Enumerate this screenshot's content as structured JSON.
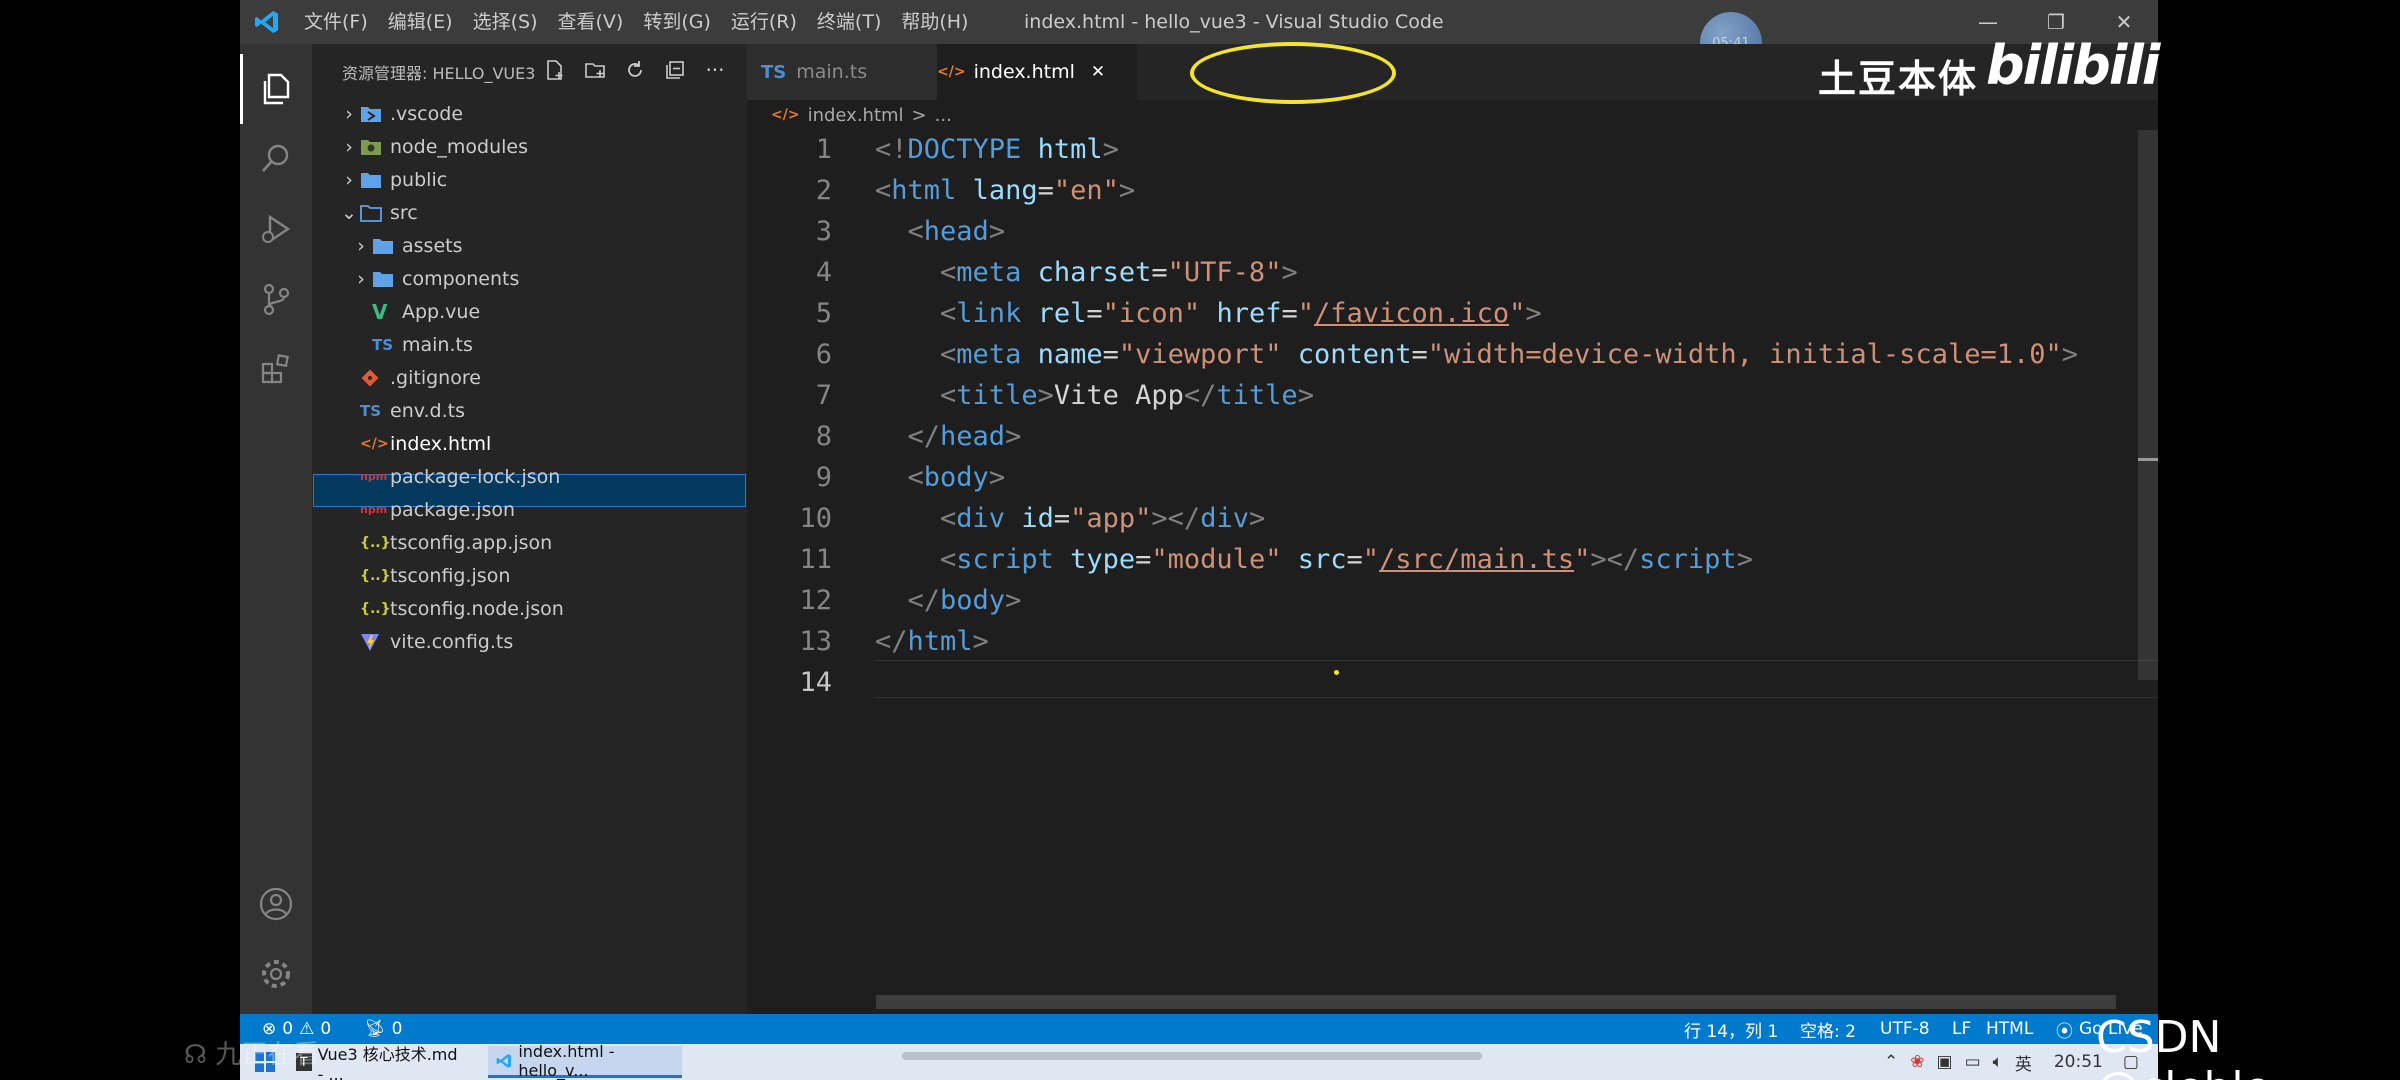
{
  "window": {
    "title": "index.html - hello_vue3 - Visual Studio Code",
    "menus": [
      "文件(F)",
      "编辑(E)",
      "选择(S)",
      "查看(V)",
      "转到(G)",
      "运行(R)",
      "终端(T)",
      "帮助(H)"
    ],
    "timer": "05:41"
  },
  "explorer": {
    "header": "资源管理器: HELLO_VUE3",
    "items": [
      {
        "label": ".vscode",
        "icon": "vscode-folder-icon"
      },
      {
        "label": "node_modules",
        "icon": "node-folder-icon"
      },
      {
        "label": "public",
        "icon": "folder-icon"
      },
      {
        "label": "src",
        "icon": "folder-open-icon"
      },
      {
        "label": "assets",
        "icon": "folder-icon"
      },
      {
        "label": "components",
        "icon": "folder-icon"
      },
      {
        "label": "App.vue",
        "icon": "vue-icon",
        "badge": "V"
      },
      {
        "label": "main.ts",
        "icon": "ts-icon",
        "badge": "TS"
      },
      {
        "label": ".gitignore",
        "icon": "git-icon"
      },
      {
        "label": "env.d.ts",
        "icon": "ts-icon",
        "badge": "TS"
      },
      {
        "label": "index.html",
        "icon": "html-icon",
        "badge": "</>"
      },
      {
        "label": "package-lock.json",
        "icon": "npm-icon",
        "badge": "npm"
      },
      {
        "label": "package.json",
        "icon": "npm-icon",
        "badge": "npm"
      },
      {
        "label": "tsconfig.app.json",
        "icon": "json-icon",
        "badge": "{..}"
      },
      {
        "label": "tsconfig.json",
        "icon": "json-icon",
        "badge": "{..}"
      },
      {
        "label": "tsconfig.node.json",
        "icon": "json-icon",
        "badge": "{..}"
      },
      {
        "label": "vite.config.ts",
        "icon": "vite-icon"
      }
    ]
  },
  "tabs": [
    {
      "label": "main.ts",
      "badge": "TS"
    },
    {
      "label": "index.html",
      "badge": "</>",
      "close": "✕"
    }
  ],
  "breadcrumb": {
    "file": "index.html",
    "sep": ">",
    "more": "..."
  },
  "editor": {
    "line_numbers": [
      "1",
      "2",
      "3",
      "4",
      "5",
      "6",
      "7",
      "8",
      "9",
      "10",
      "11",
      "12",
      "13",
      "14"
    ]
  },
  "statusbar": {
    "errors": "0",
    "warnings": "0",
    "ports": "0",
    "position": "行 14，列 1",
    "spaces": "空格: 2",
    "encoding": "UTF-8",
    "eol": "LF",
    "language": "HTML",
    "golive": "Go Live"
  },
  "taskbar": {
    "apps": [
      "Vue3 核心技术.md - ...",
      "index.html - hello_v..."
    ],
    "ime": "英",
    "time": "20:51"
  },
  "overlay": {
    "bilibili_text": "土豆本体",
    "bilibili_logo": "bilibili",
    "csdn": "CSDN @cleble",
    "watermark_left": "九正在看"
  },
  "colors": {
    "accent": "#007acc",
    "selection": "#04395e",
    "highlight_circle": "#f4e52a"
  }
}
